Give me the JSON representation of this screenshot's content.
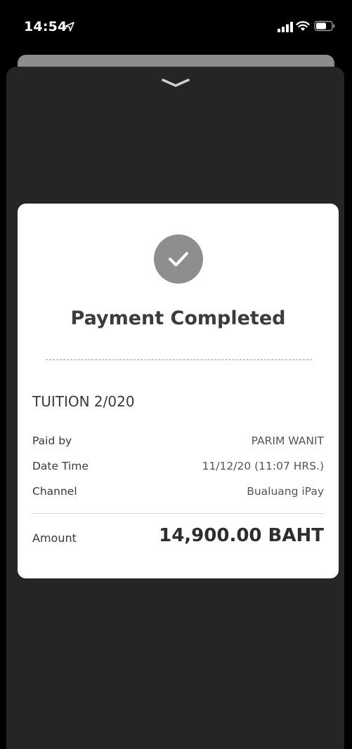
{
  "status_bar": {
    "time": "14:54",
    "icons": [
      "location-arrow-icon",
      "signal-icon",
      "wifi-icon",
      "battery-icon"
    ]
  },
  "sheet": {
    "handle_icon": "chevron-down-icon"
  },
  "receipt": {
    "status_icon": "check-icon",
    "title": "Payment Completed",
    "item_name": "TUITION 2/020",
    "rows": [
      {
        "label": "Paid by",
        "value": "PARIM WANIT"
      },
      {
        "label": "Date Time",
        "value": "11/12/20 (11:07 HRS.)"
      },
      {
        "label": "Channel",
        "value": "Bualuang iPay"
      }
    ],
    "amount_label": "Amount",
    "amount_value": "14,900.00 BAHT"
  },
  "colors": {
    "background": "#000000",
    "sheet": "#252525",
    "back_sheet": "#8c8c8c",
    "card": "#ffffff",
    "badge": "#8e8e8e"
  }
}
